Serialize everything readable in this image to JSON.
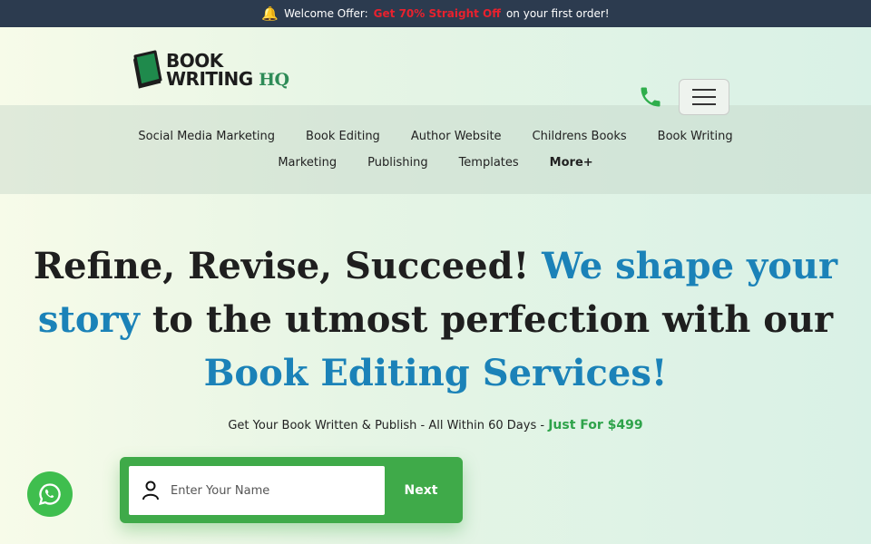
{
  "topbar": {
    "prefix": "Welcome Offer:",
    "offer": "Get 70% Straight Off",
    "suffix": "on your first order!"
  },
  "logo": {
    "line1": "BOOK",
    "line2": "WRITING",
    "hq": "HQ"
  },
  "nav": {
    "row1": [
      "Social Media Marketing",
      "Book Editing",
      "Author Website",
      "Childrens Books",
      "Book Writing"
    ],
    "row2": [
      "Marketing",
      "Publishing",
      "Templates",
      "More+"
    ]
  },
  "hero": {
    "part1": "Refine, Revise, Succeed!",
    "part2": "We shape your story",
    "part3": "to the utmost perfection with our",
    "part4": "Book Editing Services!"
  },
  "sub": {
    "text": "Get Your Book Written & Publish - All Within 60 Days -",
    "price": "Just For $499"
  },
  "form": {
    "placeholder": "Enter Your Name",
    "next_label": "Next"
  },
  "colors": {
    "accent_green": "#3faa49",
    "hero_blue": "#1b82b8",
    "offer_red": "#e8212e",
    "topbar_bg": "#2c3b4f"
  }
}
